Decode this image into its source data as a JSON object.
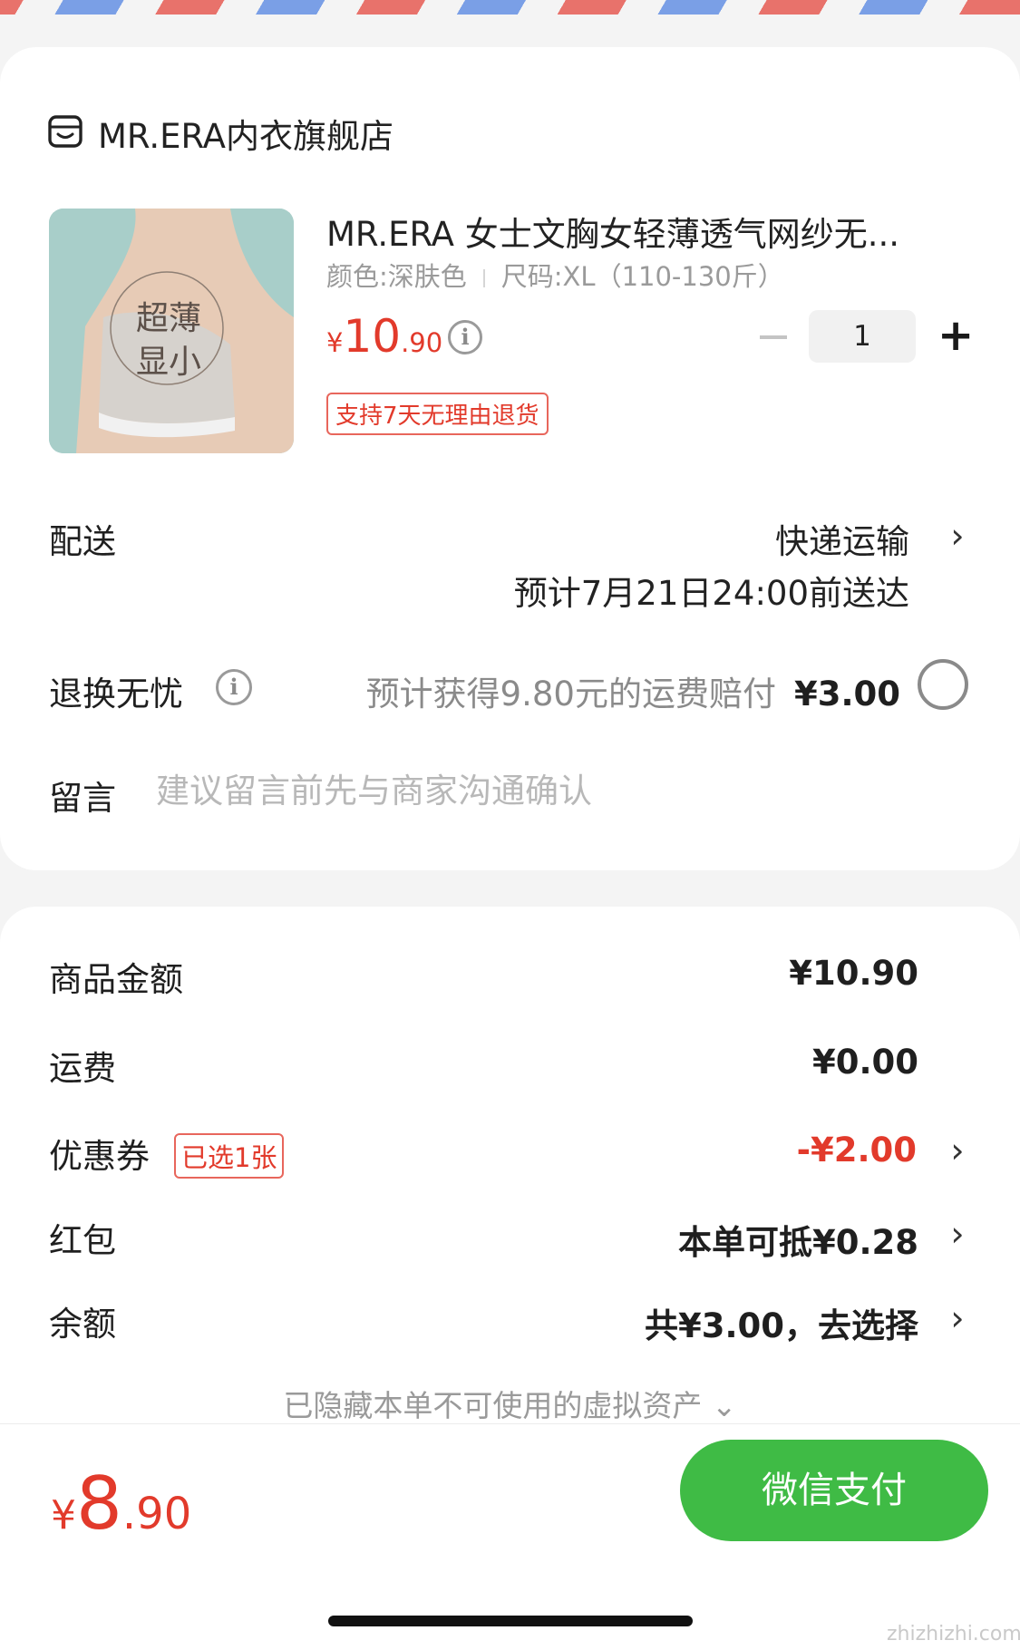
{
  "colors": {
    "accent_red": "#e23a2b",
    "pay_green": "#3fbb45"
  },
  "shop": {
    "name": "MR.ERA内衣旗舰店",
    "icon": "shop-icon"
  },
  "product": {
    "image_text_1": "超薄",
    "image_text_2": "显小",
    "title": "MR.ERA 女士文胸女轻薄透气网纱无...",
    "color_spec": "颜色:深肤色",
    "size_spec": "尺码:XL（110-130斤）",
    "price_currency": "¥",
    "price_int": "10",
    "price_dec": ".90",
    "quantity": "1",
    "return_badge": "支持7天无理由退货"
  },
  "delivery": {
    "label": "配送",
    "method": "快递运输",
    "eta": "预计7月21日24:00前送达"
  },
  "return_service": {
    "label": "退换无忧",
    "text": "预计获得9.80元的运费赔付",
    "price": "¥3.00"
  },
  "message": {
    "label": "留言",
    "placeholder": "建议留言前先与商家沟通确认"
  },
  "summary": {
    "goods_label": "商品金额",
    "goods_value": "¥10.90",
    "shipping_label": "运费",
    "shipping_value": "¥0.00",
    "coupon_label": "优惠券",
    "coupon_badge": "已选1张",
    "coupon_value": "-¥2.00",
    "redpacket_label": "红包",
    "redpacket_value": "本单可抵¥0.28",
    "balance_label": "余额",
    "balance_value": "共¥3.00，去选择",
    "hidden_note": "已隐藏本单不可使用的虚拟资产 ⌄"
  },
  "footer": {
    "total_currency": "¥",
    "total_int": "8",
    "total_dec": ".90",
    "pay_label": "微信支付"
  },
  "watermark": "zhizhizhi.com"
}
